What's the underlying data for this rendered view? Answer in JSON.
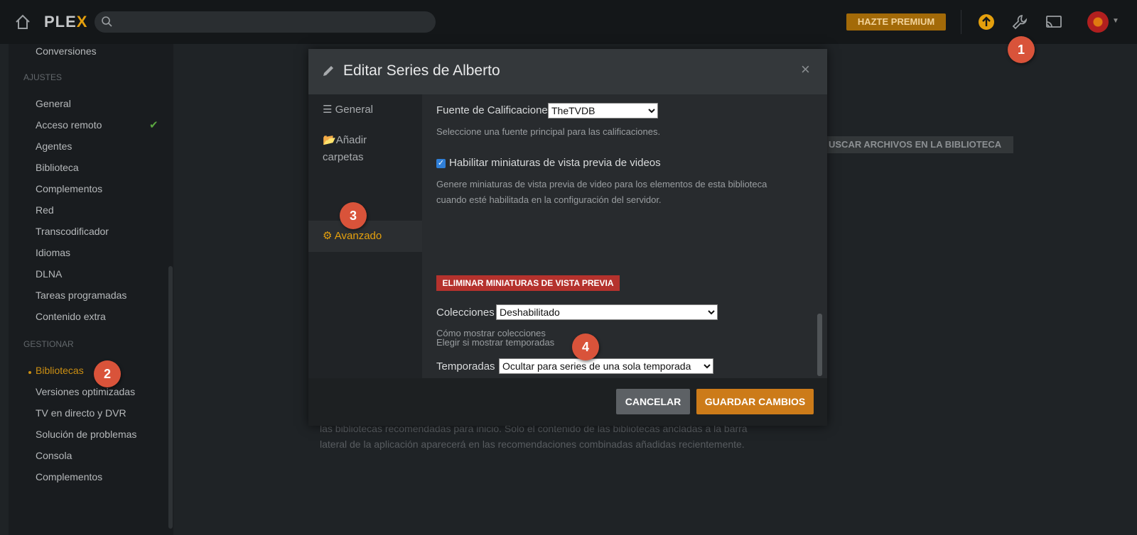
{
  "topbar": {
    "logo_prefix": "PLE",
    "logo_x": "X",
    "premium_label": "HAZTE PREMIUM",
    "icons": [
      "home-icon",
      "search-icon",
      "upload-icon",
      "wrench-icon",
      "cast-icon",
      "avatar"
    ]
  },
  "sidebar": {
    "top_item": "Conversiones",
    "section_ajustes": "AJUSTES",
    "ajustes": [
      "General",
      "Acceso remoto",
      "Agentes",
      "Biblioteca",
      "Complementos",
      "Red",
      "Transcodificador",
      "Idiomas",
      "DLNA",
      "Tareas programadas",
      "Contenido extra"
    ],
    "section_gestionar": "GESTIONAR",
    "gestionar": [
      "Bibliotecas",
      "Versiones optimizadas",
      "TV en directo y DVR",
      "Solución de problemas",
      "Consola",
      "Complementos"
    ],
    "active_item": "Bibliotecas"
  },
  "background": {
    "scan_button": "USCAR ARCHIVOS EN LA BIBLIOTECA",
    "text_line1": "las bibliotecas recomendadas para inicio. Solo el contenido de las bibliotecas ancladas a la barra",
    "text_line2": "lateral de la aplicación aparecerá en las recomendaciones combinadas añadidas recientemente."
  },
  "modal": {
    "title": "Editar Series de Alberto",
    "close": "×",
    "nav": {
      "general": "General",
      "add_folders_1": "Añadir",
      "add_folders_2": "carpetas",
      "advanced": "Avanzado"
    },
    "ratings_label": "Fuente de Calificaciones",
    "ratings_value": "TheTVDB",
    "ratings_hint": "Seleccione una fuente principal para las calificaciones.",
    "thumbnails_label": "Habilitar miniaturas de vista previa de videos",
    "thumbnails_checked": true,
    "thumbnails_hint_1": "Genere miniaturas de vista previa de video para los elementos de esta biblioteca",
    "thumbnails_hint_2": "cuando esté habilitada en la configuración del servidor.",
    "delete_thumbs_button": "ELIMINAR MINIATURAS DE VISTA PREVIA",
    "collections_label": "Colecciones",
    "collections_value": "Deshabilitado",
    "collections_hint": "Cómo mostrar colecciones",
    "seasons_label": "Temporadas",
    "seasons_value": "Ocultar para series de una sola temporada",
    "seasons_hint": "Elegir si mostrar temporadas",
    "cancel_button": "CANCELAR",
    "save_button": "GUARDAR CAMBIOS"
  },
  "markers": [
    "1",
    "2",
    "3",
    "4"
  ],
  "colors": {
    "accent": "#e5a00d",
    "marker": "#d9533a",
    "danger": "#b5322d",
    "save": "#cc7b19"
  }
}
